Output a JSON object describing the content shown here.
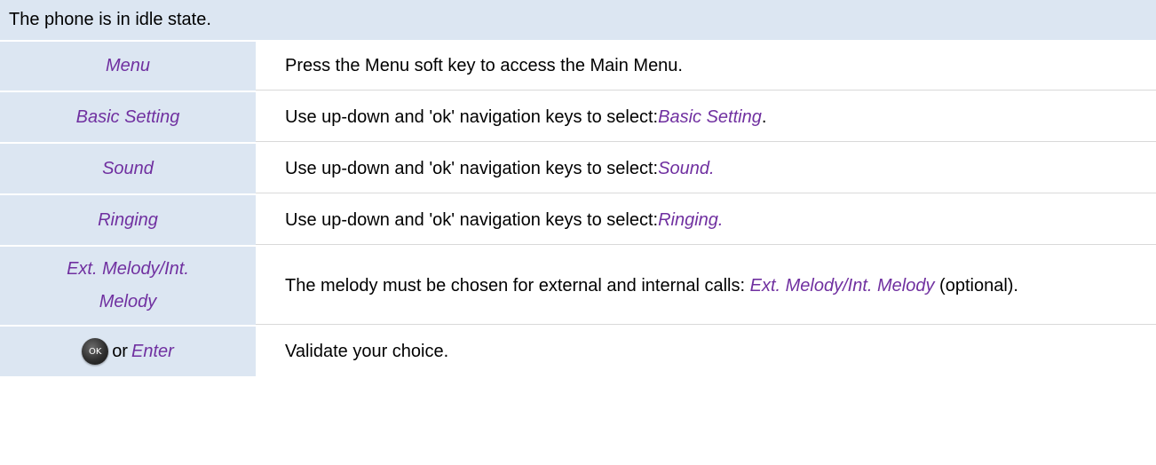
{
  "header": {
    "text": "The phone is in idle state."
  },
  "steps": [
    {
      "key": "Menu",
      "desc": "Press the Menu soft key to access the Main Menu."
    },
    {
      "key": "Basic Setting",
      "desc_pre": "Use up-down and 'ok' navigation keys to select: ",
      "desc_em": "Basic Setting",
      "desc_post": "."
    },
    {
      "key": "Sound",
      "desc_pre": "Use up-down and 'ok' navigation keys to select: ",
      "desc_em": "Sound."
    },
    {
      "key": "Ringing",
      "desc_pre": "Use up-down and 'ok' navigation keys to select: ",
      "desc_em": "Ringing."
    },
    {
      "key_line1": "Ext. Melody/Int.",
      "key_line2": "Melody",
      "desc_pre": "The melody must be chosen for external and internal calls: ",
      "desc_em": "Ext. Melody/Int. Melody",
      "desc_post": " (optional)."
    },
    {
      "icon_label": "OK",
      "or": "or",
      "key": "Enter",
      "desc": "Validate your choice."
    }
  ],
  "colors": {
    "accent": "#7030a0",
    "left_bg": "#dce6f2",
    "header_bg": "#dce6f2"
  }
}
